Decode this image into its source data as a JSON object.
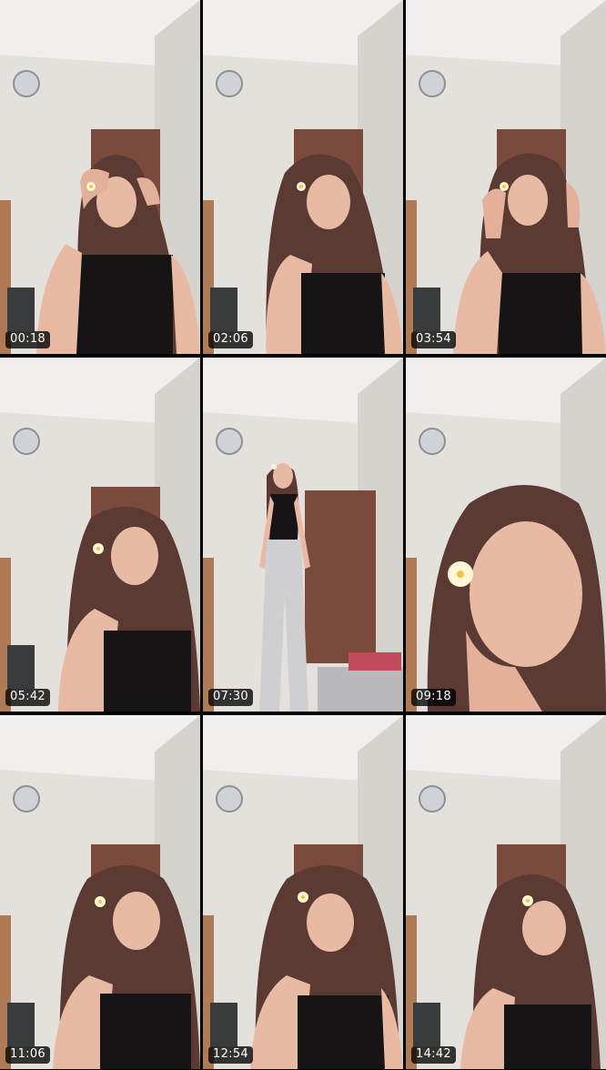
{
  "frames": [
    {
      "timestamp": "00:18",
      "pose": "hands-raised-head"
    },
    {
      "timestamp": "02:06",
      "pose": "head-tilt"
    },
    {
      "timestamp": "03:54",
      "pose": "hands-in-hair"
    },
    {
      "timestamp": "05:42",
      "pose": "lean-close"
    },
    {
      "timestamp": "07:30",
      "pose": "full-body-standing"
    },
    {
      "timestamp": "09:18",
      "pose": "chin-on-hand-close-up"
    },
    {
      "timestamp": "11:06",
      "pose": "head-tilt"
    },
    {
      "timestamp": "12:54",
      "pose": "head-tilt"
    },
    {
      "timestamp": "14:42",
      "pose": "head-turned"
    }
  ],
  "colors": {
    "wall": "#e6e3df",
    "ceiling": "#efeeec",
    "door": "#7a4a3c",
    "hair": "#5a3a33",
    "skin": "#e8b9a3",
    "top": "#141212",
    "flower": "#fff7d6",
    "timestamp_bg": "#000000",
    "timestamp_text": "#ffffff"
  }
}
